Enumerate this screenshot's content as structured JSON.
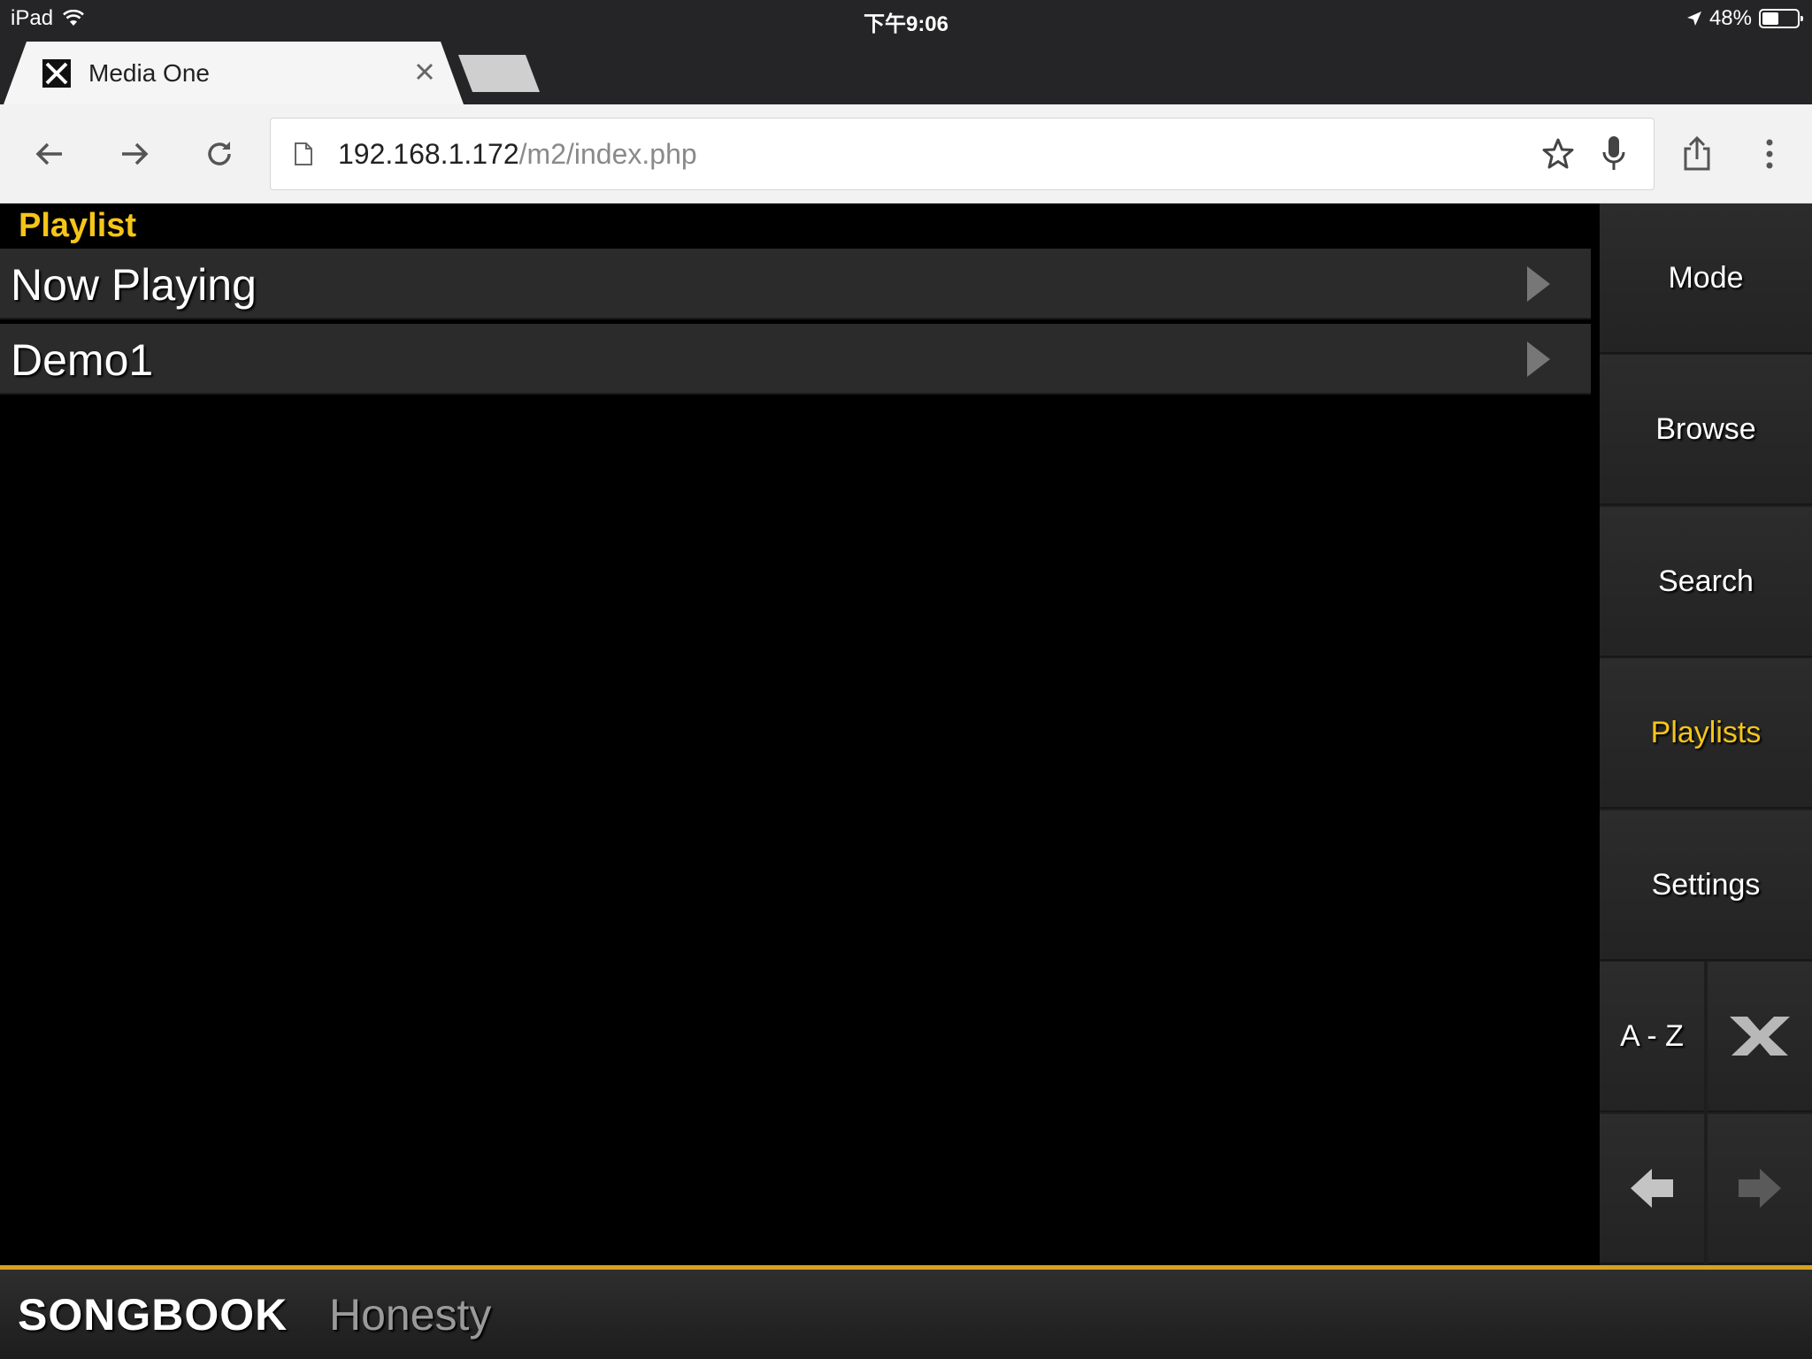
{
  "statusbar": {
    "device": "iPad",
    "time": "下午9:06",
    "battery": "48%",
    "battery_level": 0.48
  },
  "browser": {
    "tab_title": "Media One",
    "url_host": "192.168.1.172",
    "url_path": "/m2/index.php"
  },
  "content": {
    "section_title": "Playlist",
    "rows": [
      {
        "label": "Now Playing"
      },
      {
        "label": "Demo1"
      }
    ]
  },
  "sidebar": {
    "mode": "Mode",
    "browse": "Browse",
    "search": "Search",
    "playlists": "Playlists",
    "settings": "Settings",
    "az": "A - Z"
  },
  "bottombar": {
    "brand": "SONGBOOK",
    "song": "Honesty"
  },
  "colors": {
    "accent": "#f5c518",
    "bar_border": "#d8a21f"
  }
}
